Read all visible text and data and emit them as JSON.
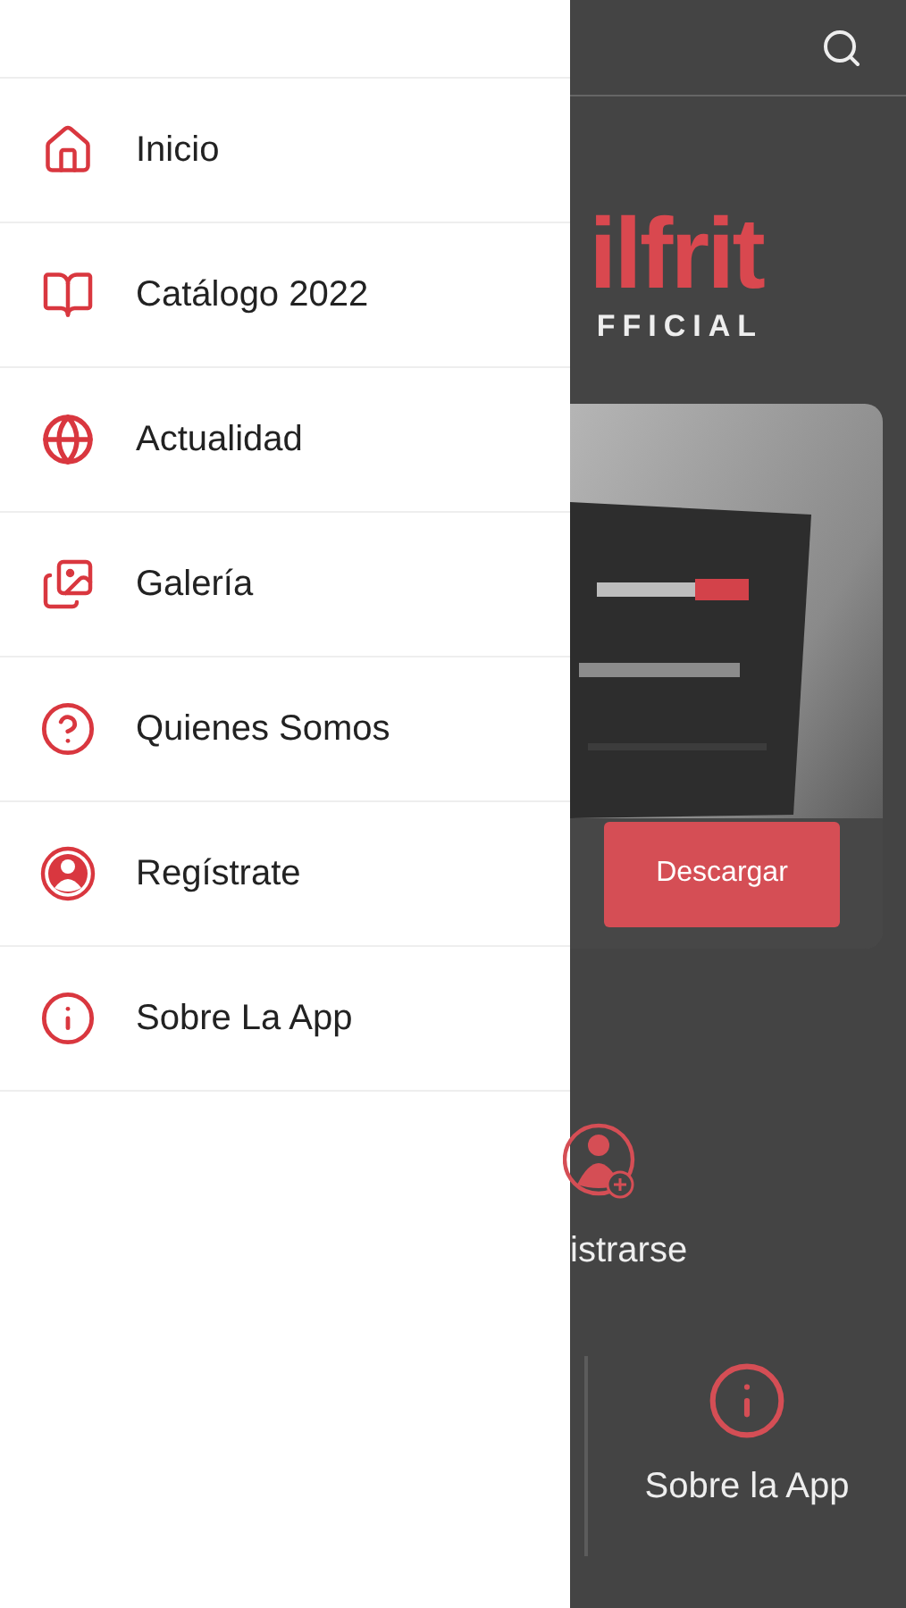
{
  "menu": {
    "items": [
      {
        "label": "Inicio"
      },
      {
        "label": "Catálogo 2022"
      },
      {
        "label": "Actualidad"
      },
      {
        "label": "Galería"
      },
      {
        "label": "Quienes Somos"
      },
      {
        "label": "Regístrate"
      },
      {
        "label": "Sobre La App"
      }
    ]
  },
  "logo": {
    "name": "ilfrit",
    "tagline": "FFICIAL"
  },
  "card": {
    "button": "Descargar"
  },
  "shortcuts": [
    {
      "label": "istrarse"
    },
    {
      "label": "Sobre la App"
    }
  ]
}
